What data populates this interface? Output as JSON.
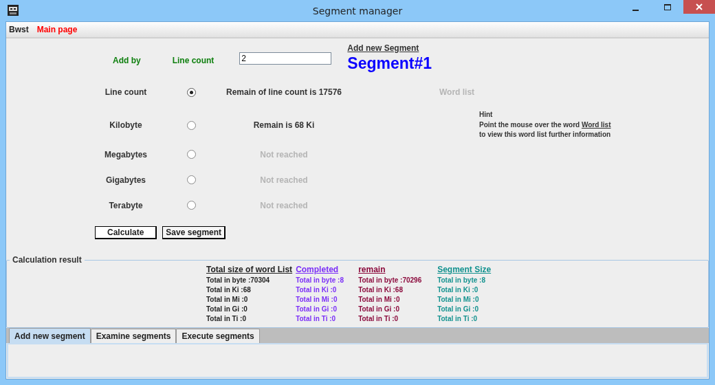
{
  "window": {
    "title": "Segment manager"
  },
  "menu": [
    {
      "label": "Bwst",
      "kind": "plain"
    },
    {
      "label": "Main page",
      "kind": "highlight"
    }
  ],
  "top": {
    "add_by_label": "Add by",
    "unit_label": "Line count",
    "value": "2",
    "add_link": "Add new Segment",
    "segment_title": "Segment#1"
  },
  "options": [
    {
      "label": "Line count",
      "selected": true,
      "remain": "Remain of line count is 17576",
      "disabled": false
    },
    {
      "label": "Kilobyte",
      "selected": false,
      "remain": "Remain is 68 Ki",
      "disabled": false
    },
    {
      "label": "Megabytes",
      "selected": false,
      "remain": "Not reached",
      "disabled": true
    },
    {
      "label": "Gigabytes",
      "selected": false,
      "remain": "Not reached",
      "disabled": true
    },
    {
      "label": "Terabyte",
      "selected": false,
      "remain": "Not reached",
      "disabled": true
    }
  ],
  "word_list": {
    "label": "Word list",
    "disabled": true
  },
  "hint": {
    "title": "Hint",
    "text_before": "Point the mouse over the word ",
    "link": "Word list",
    "text_after": "to view this word list further information"
  },
  "buttons": [
    "Calculate",
    "Save segment"
  ],
  "result": {
    "title": "Calculation result",
    "columns": [
      {
        "header": "Total size of word List",
        "color": "#222222",
        "lines": [
          "Total in byte :70304",
          "Total in Ki :68",
          "Total in Mi :0",
          "Total in Gi :0",
          "Total in Ti :0"
        ]
      },
      {
        "header": "Completed",
        "color": "#7b2ff7",
        "lines": [
          "Total in byte :8",
          "Total in Ki :0",
          "Total in Mi :0",
          "Total in Gi :0",
          "Total in Ti :0"
        ]
      },
      {
        "header": "remain",
        "color": "#8b0a3c",
        "lines": [
          "Total in byte :70296",
          "Total in Ki :68",
          "Total in Mi :0",
          "Total in Gi :0",
          "Total in Ti :0"
        ]
      },
      {
        "header": "Segment Size",
        "color": "#13928f",
        "lines": [
          "Total in byte :8",
          "Total in Ki :0",
          "Total in Mi :0",
          "Total in Gi :0",
          "Total in Ti :0"
        ]
      }
    ]
  },
  "tabs": [
    {
      "label": "Add new segment",
      "selected": true
    },
    {
      "label": "Examine segments",
      "selected": false
    },
    {
      "label": "Execute segments",
      "selected": false
    }
  ]
}
